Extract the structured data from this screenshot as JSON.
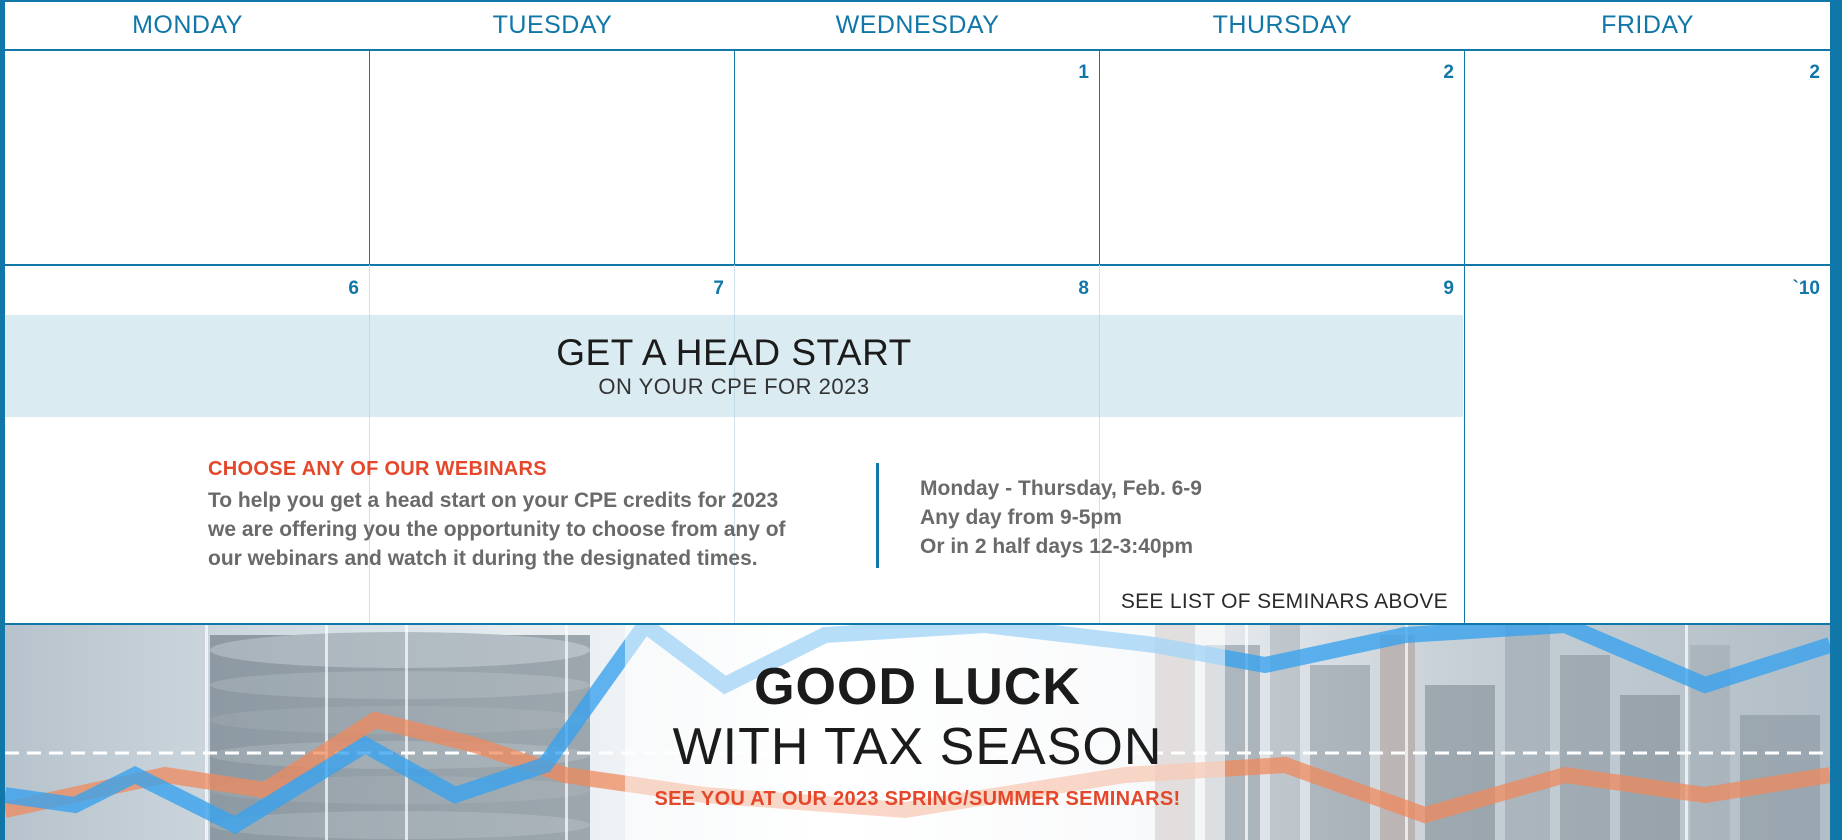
{
  "header": {
    "days": [
      "MONDAY",
      "TUESDAY",
      "WEDNESDAY",
      "THURSDAY",
      "FRIDAY"
    ]
  },
  "week1": {
    "dates": [
      "",
      "",
      "1",
      "2",
      "2"
    ]
  },
  "week2": {
    "dates": [
      "6",
      "7",
      "8",
      "9",
      "`10"
    ]
  },
  "banner": {
    "title": "GET A HEAD START",
    "subtitle": "ON YOUR CPE FOR 2023"
  },
  "promo": {
    "heading": "CHOOSE ANY OF OUR WEBINARS",
    "lines": [
      "To help you get a head start on your CPE credits for 2023",
      "we are offering you the opportunity to choose from any of",
      "our webinars and watch it during the designated times."
    ]
  },
  "schedule": {
    "lines": [
      "Monday - Thursday, Feb. 6-9",
      "Any day from 9-5pm",
      "Or in 2 half days 12-3:40pm"
    ],
    "see_list": "SEE LIST OF SEMINARS ABOVE"
  },
  "footer": {
    "line1": "GOOD LUCK",
    "line2": "WITH TAX SEASON",
    "line3": "SEE YOU AT OUR 2023 SPRING/SUMMER SEMINARS!"
  },
  "colors": {
    "accent_blue": "#1176a8",
    "accent_orange": "#e5472a",
    "banner_bg": "#dcebf2",
    "body_text": "#6a6a6a"
  }
}
